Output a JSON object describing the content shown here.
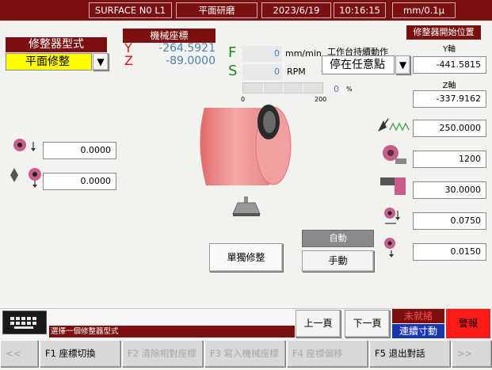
{
  "header": {
    "machine": "SURFACE N0 L1",
    "mode": "平面研磨",
    "date": "2023/6/19",
    "time": "10:16:15",
    "unit": "mm/0.1μ"
  },
  "dresser_type": {
    "label": "修整器型式",
    "value": "平面修整"
  },
  "machine_coord": {
    "label": "機械座標",
    "y_axis": "Y",
    "y_value": "-264.5921",
    "z_axis": "Z",
    "z_value": "-89.0000"
  },
  "feed": {
    "f_label": "F",
    "f_value": "0",
    "f_unit": "mm/min",
    "s_label": "S",
    "s_value": "0",
    "s_unit": "RPM",
    "bar_value": "0",
    "bar_unit": "%",
    "bar_min": "0",
    "bar_max": "200",
    "bar_percent": 0
  },
  "table_action": {
    "label": "工作台持續動作",
    "value": "停在任意點"
  },
  "dress_start": {
    "label": "修整器開始位置",
    "y_label": "Y軸",
    "y_value": "-441.5815",
    "z_label": "Z軸",
    "z_value": "-337.9162"
  },
  "right_params": [
    "250.0000",
    "1200",
    "30.0000",
    "0.0750",
    "0.0150"
  ],
  "left_params": [
    "0.0000",
    "0.0000"
  ],
  "buttons": {
    "single_dress": "單獨修整",
    "auto": "自動",
    "manual": "手動",
    "prev_page": "上一頁",
    "next_page": "下一頁",
    "not_ready": "未就緒",
    "continuous_jog": "連續寸動",
    "alarm": "警報"
  },
  "message": "選擇一個修整器型式",
  "fkeys": [
    "<<",
    "F1 座標切換",
    "F2 清除相對座標",
    "F3 寫入機械座標",
    "F4 座標偏移",
    "F5 退出對話",
    ">>"
  ],
  "colors": {
    "header_bg": "#7a1010",
    "highlight": "#ffff00",
    "coord_value": "#4a7fb0",
    "green": "#1a8a1a",
    "alarm": "#ff1a1a",
    "jog_blue": "#1a35b0"
  }
}
